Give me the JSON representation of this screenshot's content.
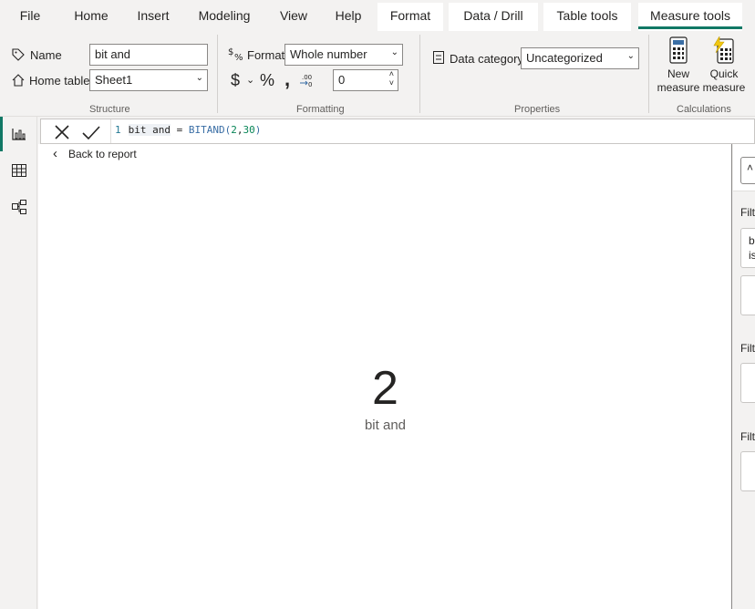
{
  "menu": {
    "tabs": [
      {
        "label": "File"
      },
      {
        "label": "Home"
      },
      {
        "label": "Insert"
      },
      {
        "label": "Modeling"
      },
      {
        "label": "View"
      },
      {
        "label": "Help"
      },
      {
        "label": "Format"
      },
      {
        "label": "Data / Drill"
      },
      {
        "label": "Table tools"
      },
      {
        "label": "Measure tools"
      }
    ],
    "active_tab": "Measure tools"
  },
  "ribbon": {
    "structure": {
      "name_label": "Name",
      "name_value": "bit and",
      "home_table_label": "Home table",
      "home_table_value": "Sheet1",
      "group_label": "Structure"
    },
    "formatting": {
      "format_label": "Format",
      "format_value": "Whole number",
      "currency_symbol": "$",
      "percent_symbol": "%",
      "comma_symbol": ",",
      "decimals_value": "0",
      "group_label": "Formatting"
    },
    "properties": {
      "data_category_label": "Data category",
      "data_category_value": "Uncategorized",
      "group_label": "Properties"
    },
    "calculations": {
      "new_measure_line1": "New",
      "new_measure_line2": "measure",
      "quick_measure_line1": "Quick",
      "quick_measure_line2": "measure",
      "group_label": "Calculations"
    }
  },
  "formula": {
    "line_number": "1",
    "measure_name": "bit and",
    "equals": "=",
    "function": "BITAND(",
    "arg1": "2",
    "comma": ",",
    "arg2": "30",
    "close": ")"
  },
  "canvas": {
    "back_label": "Back to report",
    "card_value": "2",
    "card_label": "bit and"
  },
  "filters": {
    "label1": "Filt",
    "box_text1": "b",
    "box_text2": "is",
    "label2": "Filt",
    "label3": "Filt"
  },
  "colors": {
    "accent": "#117865",
    "background": "#f3f2f1",
    "canvas": "#ffffff"
  }
}
